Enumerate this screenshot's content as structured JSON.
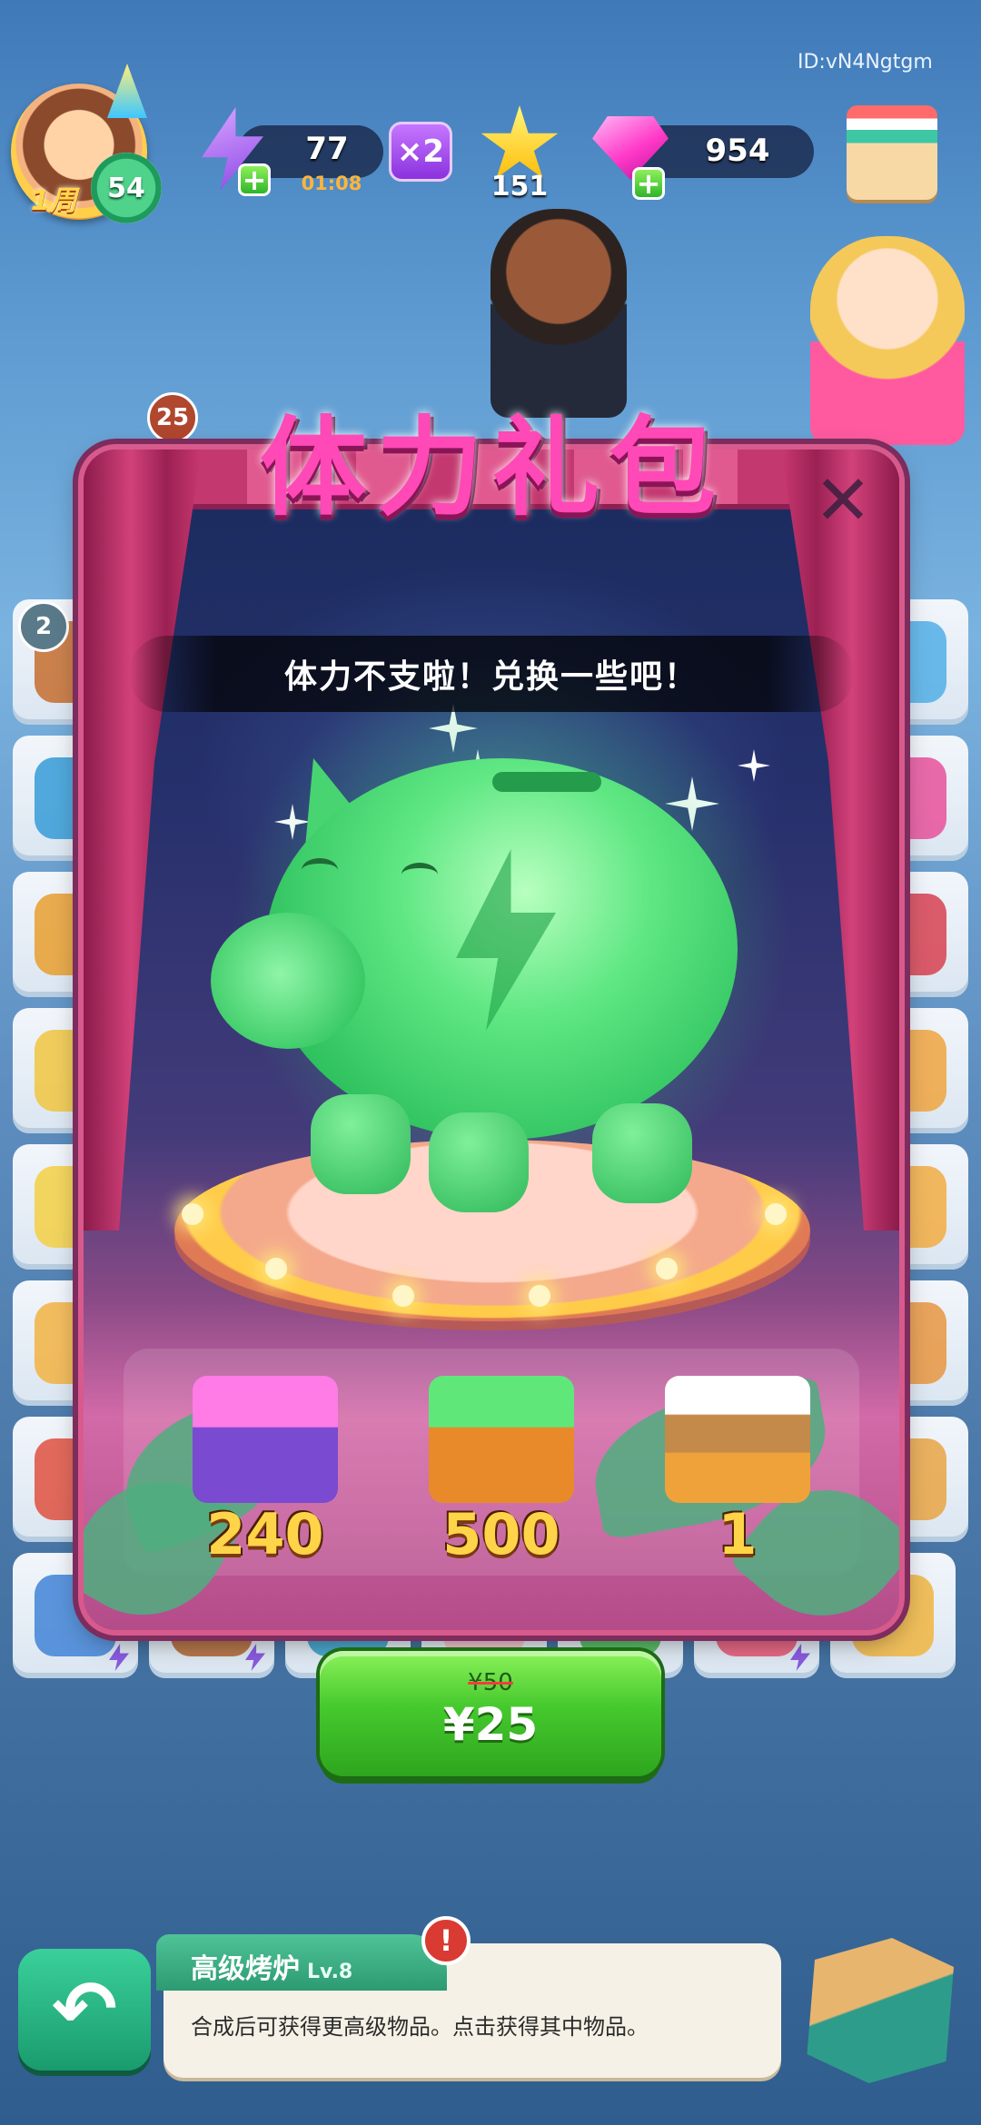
{
  "hud": {
    "player_level": "54",
    "anniversary_badge": "1周",
    "energy_value": "77",
    "energy_timer": "01:08",
    "multiplier": "×2",
    "stars": "151",
    "gems": "954",
    "user_id": "ID:vN4Ngtgm",
    "plus_symbol": "+"
  },
  "board": {
    "left_badge": "2",
    "order_badge": "25"
  },
  "popup": {
    "title": "体力礼包",
    "message": "体力不支啦！兑换一些吧！",
    "close_symbol": "✕",
    "rewards": [
      {
        "icon": "gem-chest-icon",
        "amount": "240",
        "color": "#c04ce0"
      },
      {
        "icon": "cash-chest-icon",
        "amount": "500",
        "color": "#3fbf5a"
      },
      {
        "icon": "tea-set-icon",
        "amount": "1",
        "color": "#f0a23a"
      }
    ]
  },
  "purchase": {
    "original_price": "¥50",
    "price": "¥25"
  },
  "bottom": {
    "back_symbol": "↶",
    "item_name": "高级烤炉",
    "item_level": "Lv.8",
    "item_desc": "合成后可获得更高级物品。点击获得其中物品。",
    "alert_symbol": "!"
  },
  "colors": {
    "accent_pink": "#ff49b7",
    "buy_green": "#45c92d",
    "reward_gold": "#ffd449"
  }
}
